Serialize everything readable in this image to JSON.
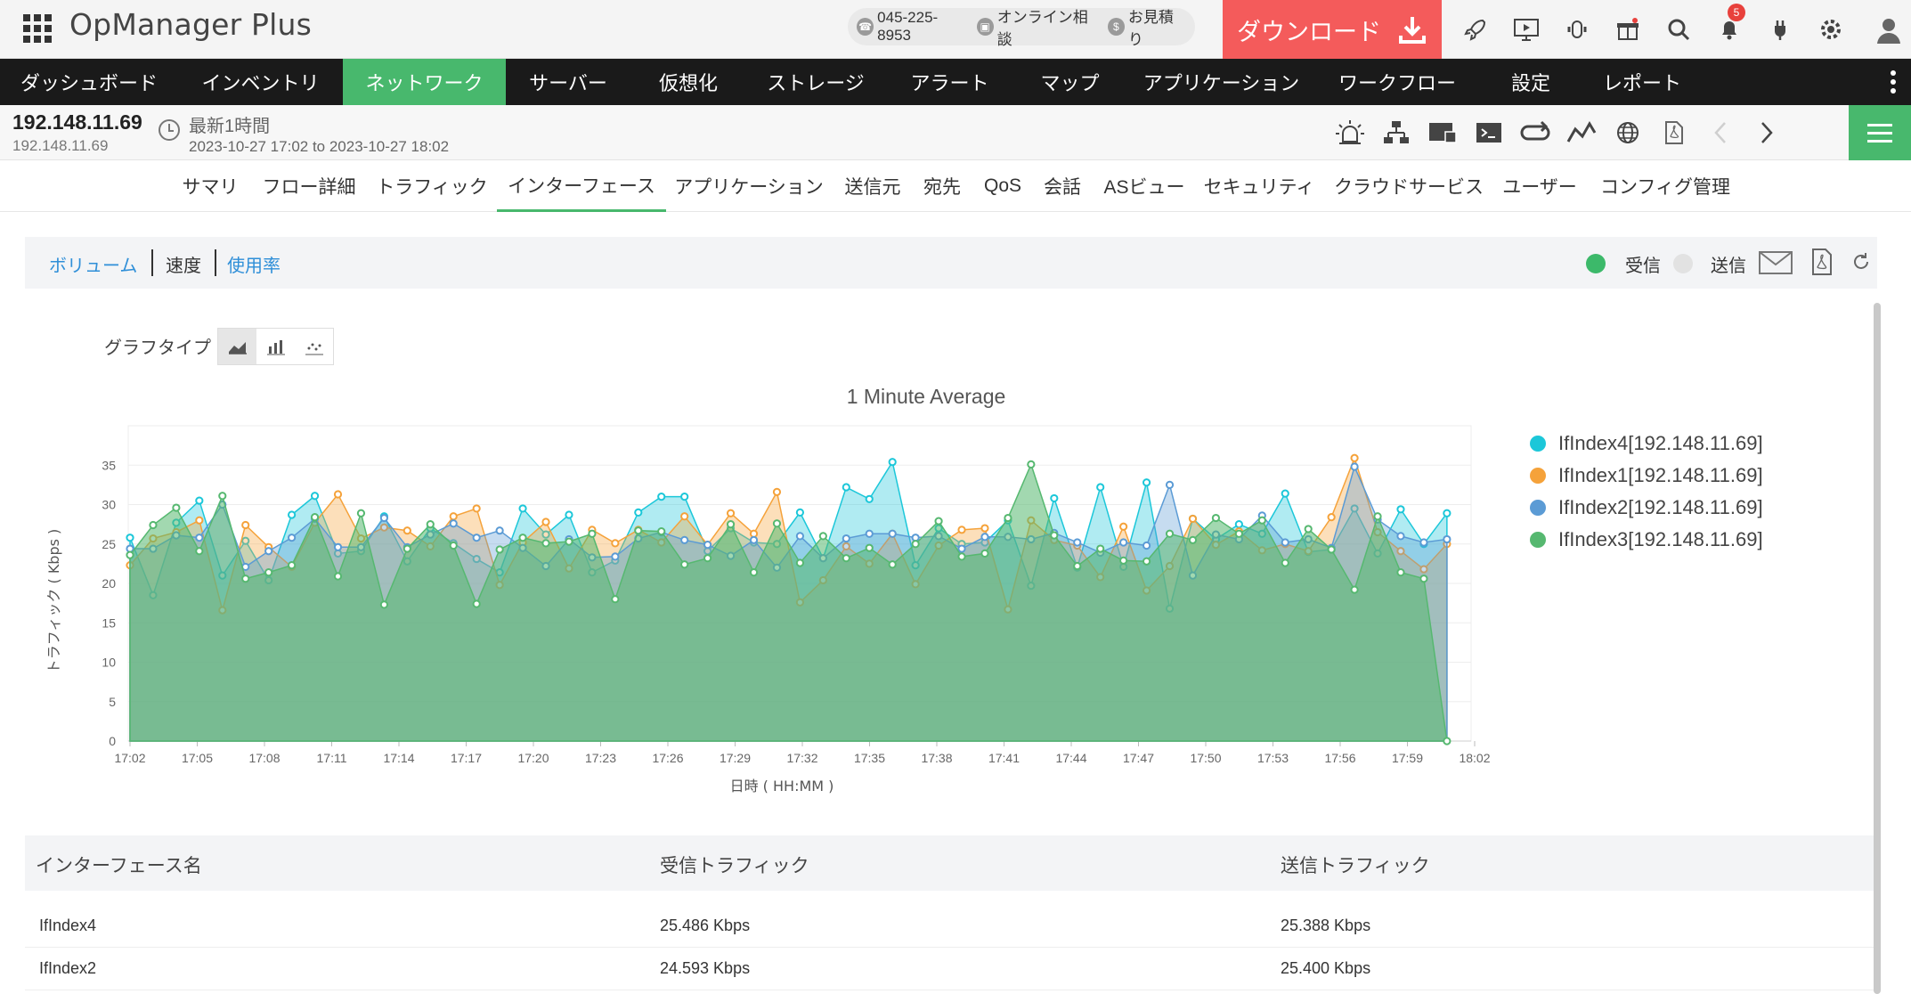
{
  "app": {
    "title": "OpManager Plus"
  },
  "topbar": {
    "phone": "045-225-8953",
    "consult": "オンライン相談",
    "quote": "お見積り",
    "download": "ダウンロード",
    "notification_count": "5",
    "accent": "#f45b5b"
  },
  "mainnav": {
    "items": [
      "ダッシュボード",
      "インベントリ",
      "ネットワーク",
      "サーバー",
      "仮想化",
      "ストレージ",
      "アラート",
      "マップ",
      "アプリケーション",
      "ワークフロー",
      "設定",
      "レポート"
    ],
    "active": "ネットワーク",
    "active_color": "#48b86d"
  },
  "device": {
    "ip": "192.148.11.69",
    "subtitle": "192.148.11.69",
    "range_label": "最新1時間",
    "range": "2023-10-27 17:02 to 2023-10-27 18:02"
  },
  "subtabs": {
    "items": [
      "サマリ",
      "フロー詳細",
      "トラフィック",
      "インターフェース",
      "アプリケーション",
      "送信元",
      "宛先",
      "QoS",
      "会話",
      "ASビュー",
      "セキュリティ",
      "クラウドサービス",
      "ユーザー",
      "コンフィグ管理"
    ],
    "active": "インターフェース"
  },
  "metrics": {
    "volume": "ボリューム",
    "speed": "速度",
    "usage": "使用率",
    "in_label": "受信",
    "out_label": "送信"
  },
  "graph_type": {
    "label": "グラフタイプ"
  },
  "chart_data": {
    "type": "area",
    "title": "1 Minute Average",
    "xlabel": "日時 ( HH:MM )",
    "ylabel": "トラフィック ( Kbps )",
    "ylim": [
      0,
      40
    ],
    "yticks": [
      0,
      5,
      10,
      15,
      20,
      25,
      30,
      35
    ],
    "xticks": [
      "17:02",
      "17:05",
      "17:08",
      "17:11",
      "17:14",
      "17:17",
      "17:20",
      "17:23",
      "17:26",
      "17:29",
      "17:32",
      "17:35",
      "17:38",
      "17:41",
      "17:44",
      "17:47",
      "17:50",
      "17:53",
      "17:56",
      "17:59",
      "18:02"
    ],
    "grid": true,
    "legend_position": "right",
    "series": [
      {
        "name": "IfIndex4[192.148.11.69]",
        "color": "#1cc7d9",
        "values": [
          25.8,
          18.5,
          27.7,
          30.5,
          21.0,
          25.4,
          20.4,
          28.7,
          31.1,
          23.8,
          24.1,
          28.5,
          22.8,
          27.0,
          25.1,
          23.1,
          21.4,
          29.5,
          26.2,
          28.7,
          21.4,
          22.9,
          29.0,
          31.0,
          31.0,
          24.1,
          27.0,
          25.2,
          25.0,
          29.0,
          23.2,
          32.2,
          30.7,
          35.4,
          22.3,
          27.0,
          25.0,
          25.2,
          28.0,
          19.7,
          30.8,
          22.0,
          32.2,
          22.1,
          32.8,
          16.8,
          28.2,
          25.6,
          27.5,
          26.3,
          31.4,
          24.0,
          24.3,
          29.5,
          23.8,
          29.4,
          25.0,
          28.9
        ]
      },
      {
        "name": "IfIndex1[192.148.11.69]",
        "color": "#f5a23a",
        "values": [
          22.3,
          25.7,
          26.5,
          28.0,
          16.6,
          27.4,
          24.6,
          22.1,
          27.7,
          31.3,
          25.7,
          27.1,
          26.7,
          24.7,
          28.5,
          29.5,
          19.8,
          25.2,
          27.8,
          21.9,
          26.8,
          25.1,
          26.8,
          25.2,
          28.5,
          24.9,
          28.9,
          26.3,
          31.6,
          17.6,
          20.4,
          24.7,
          22.5,
          26.3,
          19.9,
          24.8,
          26.8,
          27.0,
          16.7,
          28.0,
          25.5,
          24.8,
          20.8,
          27.2,
          19.1,
          22.2,
          28.2,
          24.9,
          26.6,
          24.2,
          25.0,
          24.1,
          28.4,
          35.9,
          26.5,
          24.1,
          21.8,
          25.0
        ]
      },
      {
        "name": "IfIndex2[192.148.11.69]",
        "color": "#5b9bd5",
        "values": [
          24.4,
          24.4,
          26.1,
          25.8,
          30.0,
          22.1,
          24.1,
          25.8,
          28.2,
          24.6,
          24.6,
          28.3,
          24.6,
          26.2,
          27.6,
          25.8,
          26.7,
          24.5,
          22.2,
          25.6,
          23.3,
          23.4,
          25.7,
          26.5,
          25.5,
          24.9,
          23.5,
          25.5,
          22.0,
          26.0,
          23.2,
          25.7,
          26.3,
          26.3,
          25.8,
          26.0,
          24.4,
          25.9,
          25.9,
          25.6,
          26.4,
          25.2,
          23.9,
          25.2,
          24.8,
          32.5,
          21.0,
          26.2,
          25.6,
          28.6,
          25.2,
          25.6,
          24.5,
          34.8,
          28.1,
          26.0,
          25.2,
          25.6
        ]
      },
      {
        "name": "IfIndex3[192.148.11.69]",
        "color": "#56b870",
        "values": [
          23.6,
          27.4,
          29.6,
          24.1,
          31.1,
          20.6,
          21.4,
          22.3,
          28.4,
          20.9,
          28.9,
          17.3,
          24.4,
          27.5,
          24.8,
          17.4,
          24.3,
          25.8,
          25.1,
          25.3,
          26.3,
          18.0,
          26.7,
          26.6,
          22.4,
          23.2,
          27.5,
          21.4,
          27.6,
          22.6,
          26.0,
          23.2,
          24.5,
          22.4,
          25.0,
          27.9,
          23.4,
          23.8,
          28.3,
          35.1,
          26.1,
          22.2,
          24.4,
          22.9,
          22.8,
          26.3,
          25.5,
          28.3,
          26.3,
          28.0,
          22.6,
          26.9,
          24.3,
          19.2,
          28.5,
          21.4,
          20.6,
          0
        ]
      }
    ]
  },
  "table": {
    "headers": [
      "インターフェース名",
      "受信トラフィック",
      "送信トラフィック"
    ],
    "rows": [
      {
        "name": "IfIndex4",
        "in": "25.486 Kbps",
        "out": "25.388 Kbps"
      },
      {
        "name": "IfIndex2",
        "in": "24.593 Kbps",
        "out": "25.400 Kbps"
      }
    ]
  }
}
